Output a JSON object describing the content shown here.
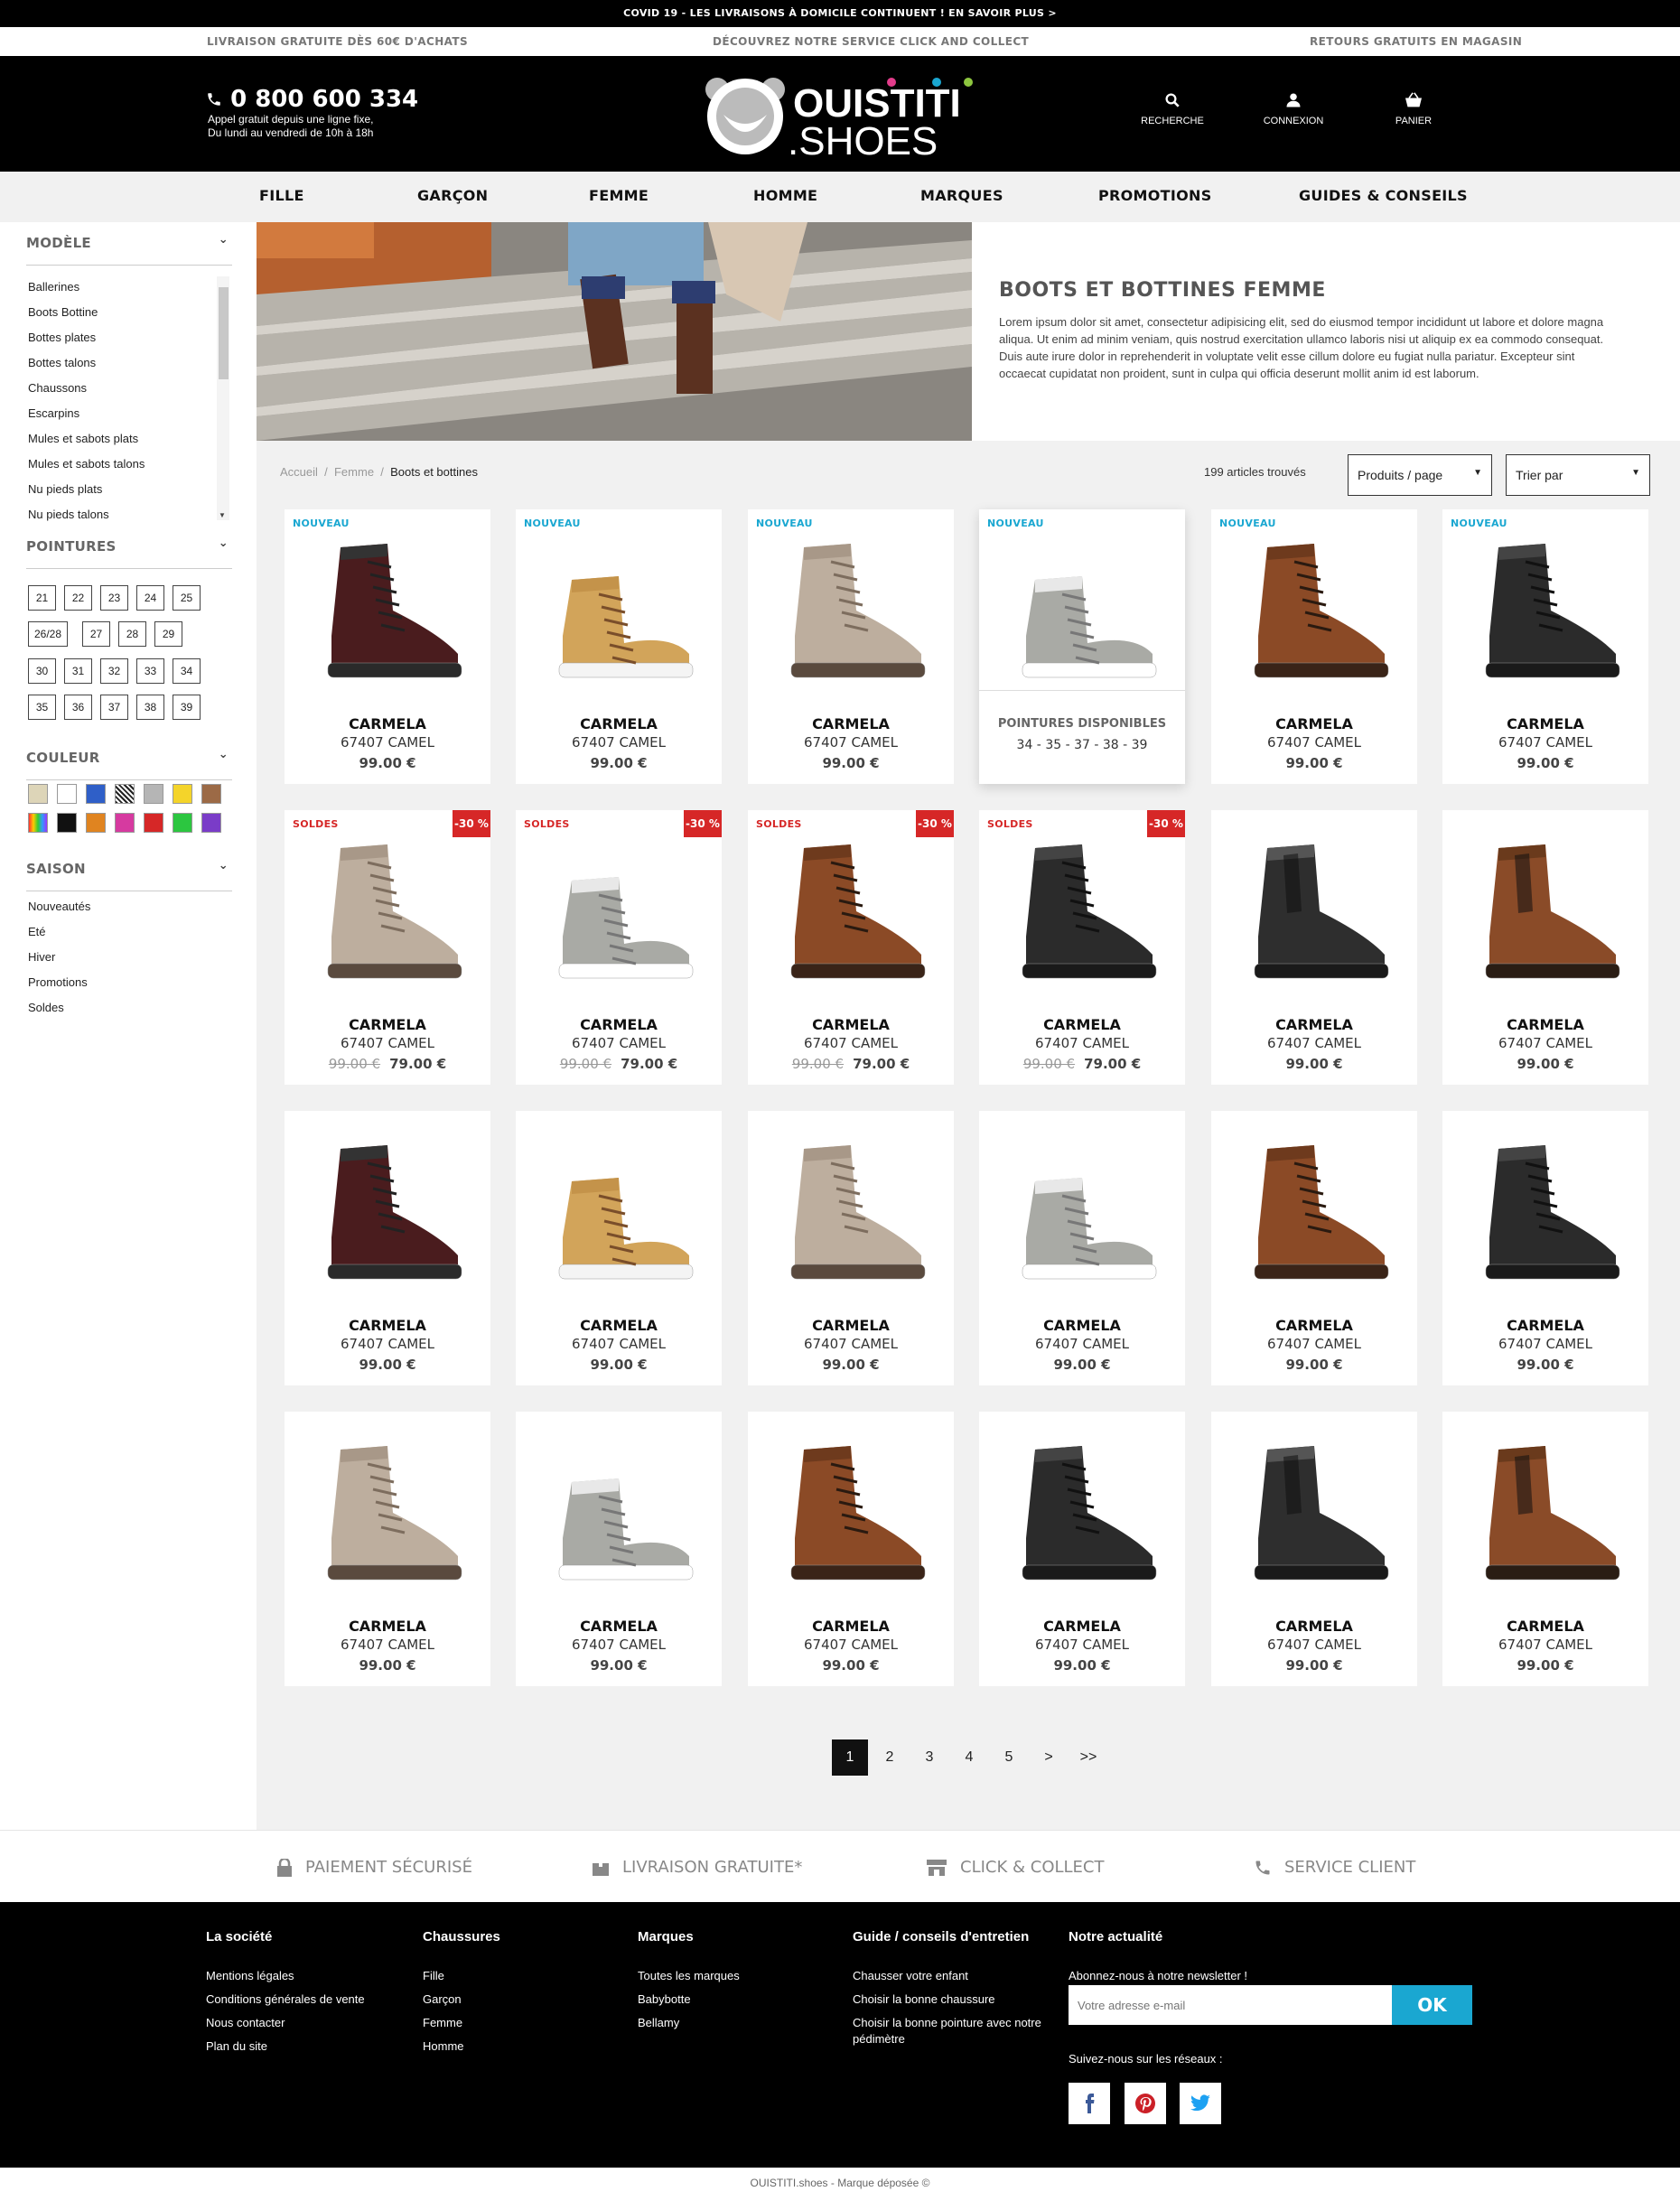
{
  "topbar": {
    "covid": "COVID 19 - LES LIVRAISONS À DOMICILE CONTINUENT ! EN SAVOIR PLUS >"
  },
  "infobar": {
    "left": "LIVRAISON GRATUITE DÈS 60€ D'ACHATS",
    "center": "DÉCOUVREZ NOTRE SERVICE CLICK AND COLLECT",
    "right": "RETOURS GRATUITS EN MAGASIN"
  },
  "header": {
    "phone": "0 800 600 334",
    "phone_sub1": "Appel gratuit depuis une ligne fixe,",
    "phone_sub2": "Du lundi au vendredi de 10h à 18h",
    "logo_top": "OUISTITI",
    "logo_bottom": ".SHOES",
    "search_label": "RECHERCHE",
    "login_label": "CONNEXION",
    "cart_label": "PANIER"
  },
  "nav": [
    "FILLE",
    "GARÇON",
    "FEMME",
    "HOMME",
    "MARQUES",
    "PROMOTIONS",
    "GUIDES & CONSEILS"
  ],
  "sidebar": {
    "modele_title": "MODÈLE",
    "modele_items": [
      "Ballerines",
      "Boots Bottine",
      "Bottes plates",
      "Bottes talons",
      "Chaussons",
      "Escarpins",
      "Mules et sabots plats",
      "Mules et sabots talons",
      "Nu pieds plats",
      "Nu pieds talons"
    ],
    "pointures_title": "POINTURES",
    "sizes": [
      [
        "21",
        "22",
        "23",
        "24",
        "25"
      ],
      [
        "26/28",
        "27",
        "28",
        "29"
      ],
      [
        "30",
        "31",
        "32",
        "33",
        "34"
      ],
      [
        "35",
        "36",
        "37",
        "38",
        "39"
      ]
    ],
    "couleur_title": "COULEUR",
    "colors_row1": [
      "#ddd5b8",
      "#ffffff",
      "#2f5fc8",
      "striped",
      "#b5b5b5",
      "#f4d42a",
      "#9c6a46"
    ],
    "colors_row2": [
      "multicolor",
      "#111111",
      "#e08420",
      "#d63aa0",
      "#d62727",
      "#2cc640",
      "#7a3cc8"
    ],
    "saison_title": "SAISON",
    "saison_items": [
      "Nouveautés",
      "Eté",
      "Hiver",
      "Promotions",
      "Soldes"
    ]
  },
  "hero": {
    "title": "BOOTS ET BOTTINES FEMME",
    "desc": "Lorem ipsum dolor sit amet, consectetur adipisicing elit, sed do eiusmod tempor incididunt ut labore et dolore magna aliqua. Ut enim ad minim veniam, quis nostrud exercitation ullamco laboris nisi ut aliquip ex ea commodo consequat. Duis aute irure dolor in reprehenderit in voluptate velit esse cillum dolore eu fugiat nulla pariatur. Excepteur sint occaecat cupidatat non proident, sunt in culpa qui officia deserunt mollit anim id est laborum."
  },
  "listing": {
    "breadcrumb": [
      "Accueil",
      "Femme",
      "Boots et bottines"
    ],
    "count": "199 articles trouvés",
    "per_page": "Produits / page",
    "sort": "Trier par"
  },
  "labels": {
    "nouveau": "NOUVEAU",
    "soldes": "SOLDES",
    "discount": "-30 %",
    "sizes_avail": "POINTURES DISPONIBLES"
  },
  "products": [
    {
      "name": "CARMELA",
      "ref": "67407 CAMEL",
      "price": "99.00 €",
      "badge": "NOUVEAU",
      "shoe": "burgundy"
    },
    {
      "name": "CARMELA",
      "ref": "67407 CAMEL",
      "price": "99.00 €",
      "badge": "NOUVEAU",
      "shoe": "tan"
    },
    {
      "name": "CARMELA",
      "ref": "67407 CAMEL",
      "price": "99.00 €",
      "badge": "NOUVEAU",
      "shoe": "taupe"
    },
    {
      "name": "CARMELA",
      "ref": "67407 CAMEL",
      "price": "99.00 €",
      "badge": "NOUVEAU",
      "shoe": "grey",
      "hover": true,
      "sizes": "34 - 35 - 37 - 38 - 39"
    },
    {
      "name": "CARMELA",
      "ref": "67407 CAMEL",
      "price": "99.00 €",
      "badge": "NOUVEAU",
      "shoe": "brown"
    },
    {
      "name": "CARMELA",
      "ref": "67407 CAMEL",
      "price": "99.00 €",
      "badge": "NOUVEAU",
      "shoe": "black"
    },
    {
      "name": "CARMELA",
      "ref": "67407 CAMEL",
      "price": "79.00 €",
      "old_price": "99.00 €",
      "badge": "SOLDES",
      "discount": true,
      "shoe": "taupe"
    },
    {
      "name": "CARMELA",
      "ref": "67407 CAMEL",
      "price": "79.00 €",
      "old_price": "99.00 €",
      "badge": "SOLDES",
      "discount": true,
      "shoe": "grey"
    },
    {
      "name": "CARMELA",
      "ref": "67407 CAMEL",
      "price": "79.00 €",
      "old_price": "99.00 €",
      "badge": "SOLDES",
      "discount": true,
      "shoe": "brown"
    },
    {
      "name": "CARMELA",
      "ref": "67407 CAMEL",
      "price": "79.00 €",
      "old_price": "99.00 €",
      "badge": "SOLDES",
      "discount": true,
      "shoe": "black"
    },
    {
      "name": "CARMELA",
      "ref": "67407 CAMEL",
      "price": "99.00 €",
      "shoe": "chelsea-black"
    },
    {
      "name": "CARMELA",
      "ref": "67407 CAMEL",
      "price": "99.00 €",
      "shoe": "chelsea-brown"
    },
    {
      "name": "CARMELA",
      "ref": "67407 CAMEL",
      "price": "99.00 €",
      "shoe": "burgundy"
    },
    {
      "name": "CARMELA",
      "ref": "67407 CAMEL",
      "price": "99.00 €",
      "shoe": "tan"
    },
    {
      "name": "CARMELA",
      "ref": "67407 CAMEL",
      "price": "99.00 €",
      "shoe": "taupe"
    },
    {
      "name": "CARMELA",
      "ref": "67407 CAMEL",
      "price": "99.00 €",
      "shoe": "grey"
    },
    {
      "name": "CARMELA",
      "ref": "67407 CAMEL",
      "price": "99.00 €",
      "shoe": "brown"
    },
    {
      "name": "CARMELA",
      "ref": "67407 CAMEL",
      "price": "99.00 €",
      "shoe": "black"
    },
    {
      "name": "CARMELA",
      "ref": "67407 CAMEL",
      "price": "99.00 €",
      "shoe": "taupe"
    },
    {
      "name": "CARMELA",
      "ref": "67407 CAMEL",
      "price": "99.00 €",
      "shoe": "grey"
    },
    {
      "name": "CARMELA",
      "ref": "67407 CAMEL",
      "price": "99.00 €",
      "shoe": "brown"
    },
    {
      "name": "CARMELA",
      "ref": "67407 CAMEL",
      "price": "99.00 €",
      "shoe": "black"
    },
    {
      "name": "CARMELA",
      "ref": "67407 CAMEL",
      "price": "99.00 €",
      "shoe": "chelsea-black"
    },
    {
      "name": "CARMELA",
      "ref": "67407 CAMEL",
      "price": "99.00 €",
      "shoe": "chelsea-brown"
    }
  ],
  "pagination": [
    "1",
    "2",
    "3",
    "4",
    "5",
    ">",
    ">>"
  ],
  "reassurance": [
    "PAIEMENT SÉCURISÉ",
    "LIVRAISON GRATUITE*",
    "CLICK & COLLECT",
    "SERVICE CLIENT"
  ],
  "footer": {
    "col1": {
      "title": "La société",
      "items": [
        "Mentions légales",
        "Conditions générales de vente",
        "Nous contacter",
        "Plan du site"
      ]
    },
    "col2": {
      "title": "Chaussures",
      "items": [
        "Fille",
        "Garçon",
        "Femme",
        "Homme"
      ]
    },
    "col3": {
      "title": "Marques",
      "items": [
        "Toutes les marques",
        "Babybotte",
        "Bellamy"
      ]
    },
    "col4": {
      "title": "Guide / conseils d'entretien",
      "items": [
        "Chausser votre enfant",
        "Choisir la bonne chaussure",
        "Choisir la bonne pointure avec notre pédimètre"
      ]
    },
    "col5": {
      "title": "Notre actualité",
      "newsletter_text": "Abonnez-nous à notre newsletter !",
      "placeholder": "Votre adresse e-mail",
      "ok": "OK",
      "social_text": "Suivez-nous sur les réseaux :"
    },
    "copyright": "OUISTITI.shoes - Marque déposée ©"
  },
  "colors": {
    "accent": "#1aa7d1",
    "sale": "#d62727"
  }
}
